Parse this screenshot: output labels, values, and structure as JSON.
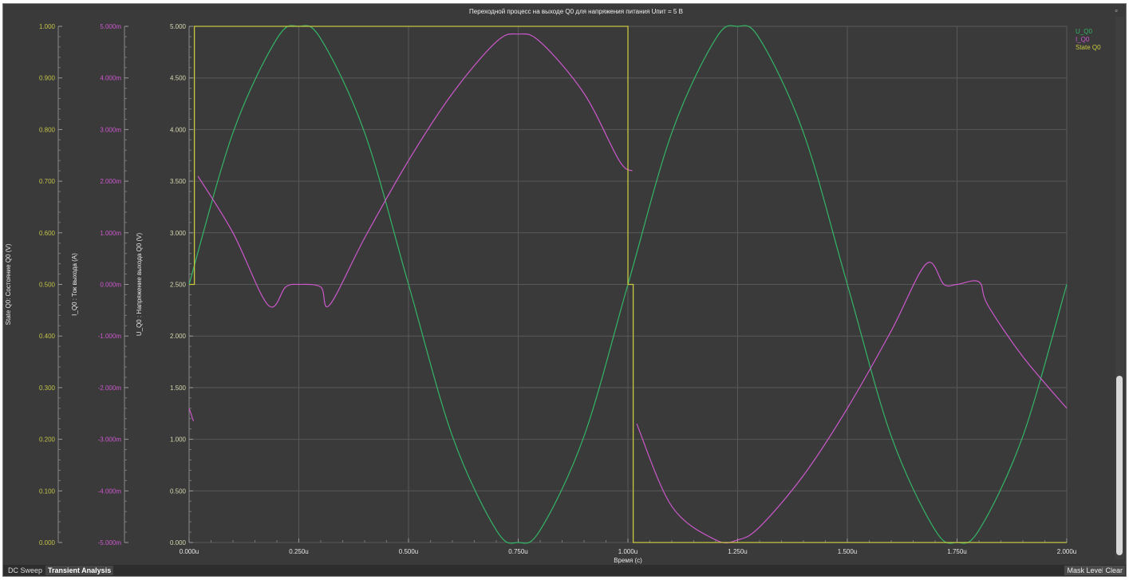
{
  "chart_data": {
    "type": "line",
    "title": "Переходной процесс на выходе Q0 для напряжения питания Uпит = 5 В",
    "xlabel": "Время (с)",
    "xlim": [
      0,
      2.0
    ],
    "x_ticks": [
      "0.000u",
      "0.250u",
      "0.500u",
      "0.750u",
      "1.000u",
      "1.250u",
      "1.500u",
      "1.750u",
      "2.000u"
    ],
    "axes": [
      {
        "id": "state",
        "label": "State Q0: Состояние Q0 (V)",
        "color": "#c2c24a",
        "range": [
          0,
          1.0
        ],
        "ticks": [
          "1.000",
          "0.900",
          "0.800",
          "0.700",
          "0.600",
          "0.500",
          "0.400",
          "0.300",
          "0.200",
          "0.100",
          "0.000"
        ]
      },
      {
        "id": "current",
        "label": "I_Q0 : Ток выхода (A)",
        "color": "#cc58cc",
        "range": [
          -0.005,
          0.005
        ],
        "ticks": [
          "5.000m",
          "4.000m",
          "3.000m",
          "2.000m",
          "1.000m",
          "0.000m",
          "-1.000m",
          "-2.000m",
          "-3.000m",
          "-4.000m",
          "-5.000m"
        ]
      },
      {
        "id": "voltage",
        "label": "U_Q0 : Напряжение выхода Q0 (V)",
        "color": "#d6d6b0",
        "range": [
          0,
          5.0
        ],
        "ticks": [
          "5.000",
          "4.500",
          "4.000",
          "3.500",
          "3.000",
          "2.500",
          "2.000",
          "1.500",
          "1.000",
          "0.500",
          "0.000"
        ]
      }
    ],
    "series": [
      {
        "name": "U_Q0",
        "axis": "voltage",
        "color": "#33b566",
        "x": [
          0,
          0.1,
          0.2,
          0.25,
          0.3,
          0.4,
          0.5,
          0.6,
          0.7,
          0.75,
          0.8,
          0.9,
          1.0,
          1.1,
          1.2,
          1.25,
          1.3,
          1.4,
          1.5,
          1.6,
          1.7,
          1.75,
          1.8,
          1.9,
          2.0
        ],
        "y": [
          2.5,
          3.97,
          4.88,
          5.0,
          4.88,
          3.97,
          2.5,
          1.03,
          0.12,
          0.0,
          0.12,
          1.03,
          2.5,
          3.97,
          4.88,
          5.0,
          4.88,
          3.97,
          2.5,
          1.03,
          0.12,
          0.0,
          0.12,
          1.03,
          2.5
        ]
      },
      {
        "name": "I_Q0",
        "axis": "current",
        "color": "#cc58cc",
        "x": [
          0,
          0.01,
          0.02,
          0.1,
          0.18,
          0.22,
          0.25,
          0.3,
          0.32,
          0.4,
          0.5,
          0.6,
          0.7,
          0.75,
          0.8,
          0.9,
          0.98,
          1.01,
          1.02,
          1.1,
          1.2,
          1.25,
          1.3,
          1.4,
          1.5,
          1.6,
          1.68,
          1.72,
          1.75,
          1.8,
          1.82,
          1.9,
          2.0
        ],
        "y": [
          -2.4,
          -2.65,
          2.1,
          1.0,
          -0.4,
          -0.05,
          0.0,
          -0.05,
          -0.4,
          0.9,
          2.4,
          3.7,
          4.7,
          4.85,
          4.7,
          3.7,
          2.4,
          2.2,
          -2.7,
          -4.3,
          -4.95,
          -4.95,
          -4.7,
          -3.7,
          -2.4,
          -0.9,
          0.4,
          0.0,
          0.0,
          0.05,
          -0.4,
          -1.4,
          -2.4
        ]
      },
      {
        "name": "State Q0",
        "axis": "state",
        "color": "#c8c840",
        "x": [
          0,
          0.012,
          0.012,
          1.0,
          1.0,
          1.012,
          1.012,
          2.0
        ],
        "y": [
          0.5,
          0.5,
          1.0,
          1.0,
          0.5,
          0.5,
          0.0,
          0.0
        ]
      }
    ],
    "legend": [
      "U_Q0",
      "I_Q0",
      "State Q0"
    ],
    "legend_position": "top-right",
    "grid": true
  },
  "tabs": {
    "dc_sweep": "DC Sweep",
    "transient": "Transient Analysis"
  },
  "buttons": {
    "mask_level": "Mask Level",
    "clear": "Clear"
  }
}
